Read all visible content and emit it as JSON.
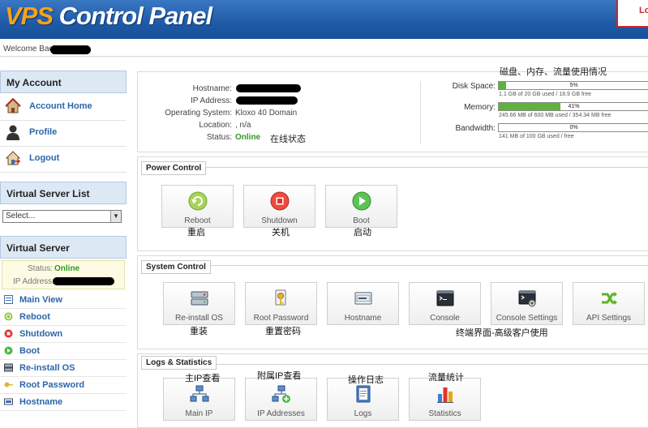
{
  "header": {
    "logo_prefix": "VPS",
    "logo_rest": " Control Panel",
    "logout_fragment": "Lo"
  },
  "welcome": "Welcome Back",
  "sidebar": {
    "my_account": {
      "title": "My Account",
      "items": [
        {
          "label": "Account Home",
          "icon": "home-icon"
        },
        {
          "label": "Profile",
          "icon": "user-icon"
        },
        {
          "label": "Logout",
          "icon": "logout-house-icon"
        }
      ]
    },
    "server_list": {
      "title": "Virtual Server List",
      "select_value": "Select..."
    },
    "virtual_server": {
      "title": "Virtual Server",
      "status_label": "Status:",
      "status_value": "Online",
      "ip_label": "IP Address:",
      "items": [
        {
          "label": "Main View",
          "icon": "main-view-icon"
        },
        {
          "label": "Reboot",
          "icon": "reboot-icon"
        },
        {
          "label": "Shutdown",
          "icon": "shutdown-icon"
        },
        {
          "label": "Boot",
          "icon": "boot-icon"
        },
        {
          "label": "Re-install OS",
          "icon": "reinstall-icon"
        },
        {
          "label": "Root Password",
          "icon": "key-icon"
        },
        {
          "label": "Hostname",
          "icon": "hostname-icon"
        }
      ]
    }
  },
  "server_info": {
    "hostname_label": "Hostname:",
    "ip_label": "IP Address:",
    "os_label": "Operating System:",
    "os_value": "Kloxo 40 Domain",
    "location_label": "Location:",
    "location_value": ", n/a",
    "status_label": "Status:",
    "status_value": "Online",
    "status_note": "在线状态"
  },
  "resources": {
    "heading_note": "磁盘、内存、流量使用情况",
    "disk": {
      "label": "Disk Space:",
      "percent": 5,
      "percent_text": "5%",
      "detail": "1.1 GB of 20 GB used / 18.9 GB free"
    },
    "memory": {
      "label": "Memory:",
      "percent": 41,
      "percent_text": "41%",
      "detail": "245.66 MB of 600 MB used / 354.34 MB free"
    },
    "bandwidth": {
      "label": "Bandwidth:",
      "percent": 0,
      "percent_text": "0%",
      "detail": "141 MB of 100 GB used / free"
    }
  },
  "power_control": {
    "title": "Power Control",
    "tiles": [
      {
        "label": "Reboot",
        "note": "重启",
        "icon": "reboot-icon",
        "color": "#8dc63f"
      },
      {
        "label": "Shutdown",
        "note": "关机",
        "icon": "shutdown-icon",
        "color": "#e5322d"
      },
      {
        "label": "Boot",
        "note": "启动",
        "icon": "boot-icon",
        "color": "#4cb848"
      }
    ]
  },
  "system_control": {
    "title": "System Control",
    "tiles": [
      {
        "label": "Re-install OS",
        "note": "重装",
        "icon": "reinstall-icon"
      },
      {
        "label": "Root Password",
        "note": "重置密码",
        "icon": "key-icon"
      },
      {
        "label": "Hostname",
        "note": "",
        "icon": "hostname-icon"
      },
      {
        "label": "Console",
        "note": "",
        "icon": "console-icon"
      },
      {
        "label": "Console Settings",
        "note": "",
        "icon": "console-settings-icon"
      },
      {
        "label": "API Settings",
        "note": "",
        "icon": "api-icon"
      }
    ],
    "console_note": "终端界面-高级客户使用"
  },
  "logs_statistics": {
    "title": "Logs & Statistics",
    "tiles": [
      {
        "label": "Main IP",
        "note": "主IP查看",
        "icon": "network-icon"
      },
      {
        "label": "IP Addresses",
        "note": "附属IP查看",
        "icon": "network-add-icon"
      },
      {
        "label": "Logs",
        "note": "操作日志",
        "icon": "logs-icon"
      },
      {
        "label": "Statistics",
        "note": "流量统计",
        "icon": "statistics-icon"
      }
    ]
  },
  "colors": {
    "header": "#1e5aa6",
    "logo_accent": "#f7a21b",
    "link": "#2c65a8",
    "online": "#2e9a1f",
    "bar_fill": "#5db33c"
  }
}
